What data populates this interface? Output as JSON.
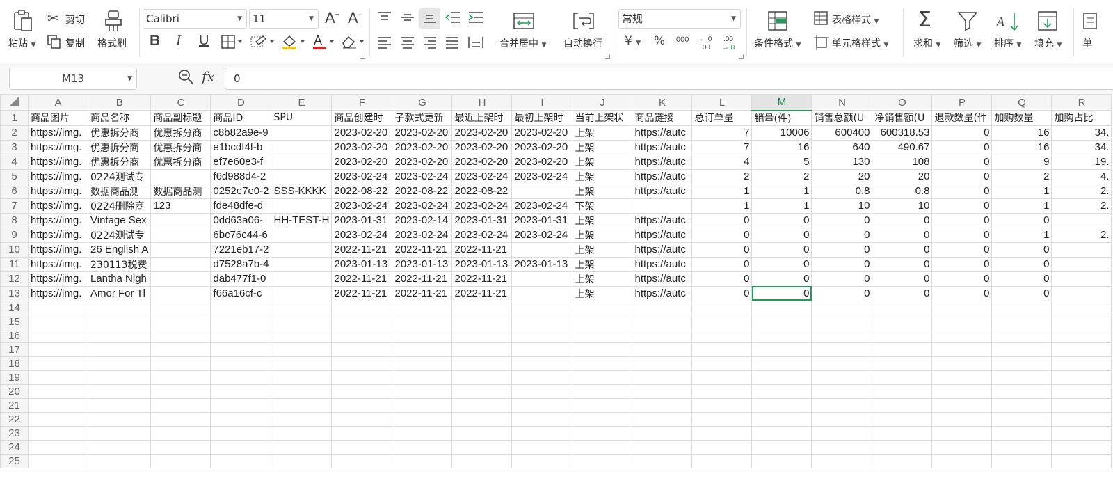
{
  "ribbon": {
    "paste": "粘贴",
    "cut": "剪切",
    "copy": "复制",
    "format_painter": "格式刷",
    "font_name": "Calibri",
    "font_size": "11",
    "bold": "B",
    "italic": "I",
    "underline": "U",
    "merge_center": "合并居中",
    "wrap_text": "自动换行",
    "number_format": "常规",
    "currency": "¥",
    "percent": "%",
    "thousands": "000",
    "conditional_format": "条件格式",
    "table_style": "表格样式",
    "cell_style": "单元格样式",
    "sum": "求和",
    "filter": "筛选",
    "sort": "排序",
    "fill": "填充",
    "cut_off": "单"
  },
  "formula_bar": {
    "cell_ref": "M13",
    "fx": "fx",
    "value": "0"
  },
  "sheet": {
    "columns": [
      "A",
      "B",
      "C",
      "D",
      "E",
      "F",
      "G",
      "H",
      "I",
      "J",
      "K",
      "L",
      "M",
      "N",
      "O",
      "P",
      "Q",
      "R"
    ],
    "header_row": [
      "商品图片",
      "商品名称",
      "商品副标题",
      "商品ID",
      "SPU",
      "商品创建时",
      "子款式更新",
      "最近上架时",
      "最初上架时",
      "当前上架状",
      "商品链接",
      "总订单量",
      "销量(件)",
      "销售总额(U",
      "净销售额(U",
      "退款数量(件",
      "加购数量",
      "加购占比"
    ],
    "rows": [
      [
        "https://img.",
        "优惠拆分商",
        "优惠拆分商",
        "c8b82a9e-9",
        "",
        "2023-02-20",
        "2023-02-20",
        "2023-02-20",
        "2023-02-20",
        "上架",
        "https://autc",
        "7",
        "10006",
        "600400",
        "600318.53",
        "0",
        "16",
        "34."
      ],
      [
        "https://img.",
        "优惠拆分商",
        "优惠拆分商",
        "e1bcdf4f-b",
        "",
        "2023-02-20",
        "2023-02-20",
        "2023-02-20",
        "2023-02-20",
        "上架",
        "https://autc",
        "7",
        "16",
        "640",
        "490.67",
        "0",
        "16",
        "34."
      ],
      [
        "https://img.",
        "优惠拆分商",
        "优惠拆分商",
        "ef7e60e3-f",
        "",
        "2023-02-20",
        "2023-02-20",
        "2023-02-20",
        "2023-02-20",
        "上架",
        "https://autc",
        "4",
        "5",
        "130",
        "108",
        "0",
        "9",
        "19."
      ],
      [
        "https://img.",
        "0224测试专",
        "",
        "f6d988d4-2",
        "",
        "2023-02-24",
        "2023-02-24",
        "2023-02-24",
        "2023-02-24",
        "上架",
        "https://autc",
        "2",
        "2",
        "20",
        "20",
        "0",
        "2",
        "4."
      ],
      [
        "https://img.",
        "数据商品测",
        "数据商品测",
        "0252e7e0-2",
        "SSS-KKKK",
        "2022-08-22",
        "2022-08-22",
        "2022-08-22",
        "",
        "上架",
        "https://autc",
        "1",
        "1",
        "0.8",
        "0.8",
        "0",
        "1",
        "2."
      ],
      [
        "https://img.",
        "0224删除商",
        "123",
        "fde48dfe-d",
        "",
        "2023-02-24",
        "2023-02-24",
        "2023-02-24",
        "2023-02-24",
        "下架",
        "",
        "1",
        "1",
        "10",
        "10",
        "0",
        "1",
        "2."
      ],
      [
        "https://img.",
        "Vintage Sex",
        "",
        "0dd63a06-",
        "HH-TEST-H",
        "2023-01-31",
        "2023-02-14",
        "2023-01-31",
        "2023-01-31",
        "上架",
        "https://autc",
        "0",
        "0",
        "0",
        "0",
        "0",
        "0",
        ""
      ],
      [
        "https://img.",
        "0224测试专",
        "",
        "6bc76c44-6",
        "",
        "2023-02-24",
        "2023-02-24",
        "2023-02-24",
        "2023-02-24",
        "上架",
        "https://autc",
        "0",
        "0",
        "0",
        "0",
        "0",
        "1",
        "2."
      ],
      [
        "https://img.",
        "26 English A",
        "",
        "7221eb17-2",
        "",
        "2022-11-21",
        "2022-11-21",
        "2022-11-21",
        "",
        "上架",
        "https://autc",
        "0",
        "0",
        "0",
        "0",
        "0",
        "0",
        ""
      ],
      [
        "https://img.",
        "230113税费",
        "",
        "d7528a7b-4",
        "",
        "2023-01-13",
        "2023-01-13",
        "2023-01-13",
        "2023-01-13",
        "上架",
        "https://autc",
        "0",
        "0",
        "0",
        "0",
        "0",
        "0",
        ""
      ],
      [
        "https://img.",
        "Lantha Nigh",
        "",
        "dab477f1-0",
        "",
        "2022-11-21",
        "2022-11-21",
        "2022-11-21",
        "",
        "上架",
        "https://autc",
        "0",
        "0",
        "0",
        "0",
        "0",
        "0",
        ""
      ],
      [
        "https://img.",
        "Amor For Tl",
        "",
        "f66a16cf-c",
        "",
        "2022-11-21",
        "2022-11-21",
        "2022-11-21",
        "",
        "上架",
        "https://autc",
        "0",
        "0",
        "0",
        "0",
        "0",
        "0",
        ""
      ]
    ],
    "empty_row_numbers": [
      "14",
      "15",
      "16",
      "17",
      "18",
      "19",
      "20",
      "21",
      "22",
      "23",
      "24",
      "25"
    ],
    "active_cell": "M13",
    "accent_color": "#1e9d5a"
  }
}
